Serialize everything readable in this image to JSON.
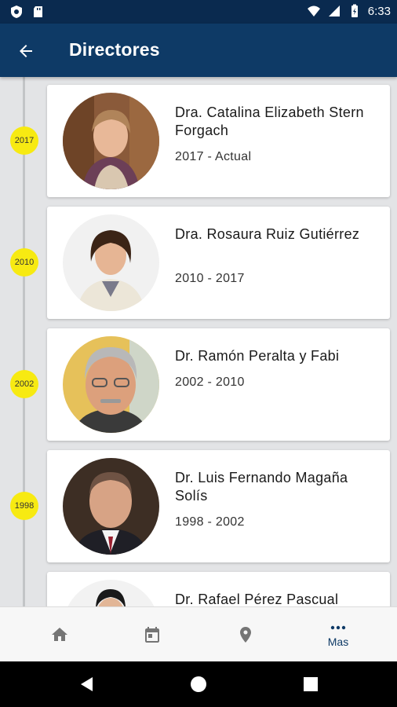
{
  "status_bar": {
    "time": "6:33"
  },
  "app_bar": {
    "title": "Directores"
  },
  "directors": [
    {
      "name": "Dra. Catalina Elizabeth Stern Forgach",
      "period": "2017 - Actual",
      "year": "2017"
    },
    {
      "name": "Dra. Rosaura Ruiz Gutiérrez",
      "period": "2010 - 2017",
      "year": "2010"
    },
    {
      "name": "Dr. Ramón Peralta y Fabi",
      "period": "2002 - 2010",
      "year": "2002"
    },
    {
      "name": "Dr. Luis Fernando Magaña Solís",
      "period": "1998 - 2002",
      "year": "1998"
    },
    {
      "name": "Dr. Rafael Pérez Pascual",
      "period": "",
      "year": ""
    }
  ],
  "bottom_nav": {
    "items": [
      {
        "icon": "home-icon",
        "label": ""
      },
      {
        "icon": "calendar-icon",
        "label": ""
      },
      {
        "icon": "location-pin-icon",
        "label": ""
      },
      {
        "icon": "more-icon",
        "label": "Mas"
      }
    ]
  },
  "colors": {
    "app_bar": "#0e3a66",
    "status_bar": "#0a2a4f",
    "year_dot": "#f7ea12",
    "accent": "#0e3a66"
  }
}
